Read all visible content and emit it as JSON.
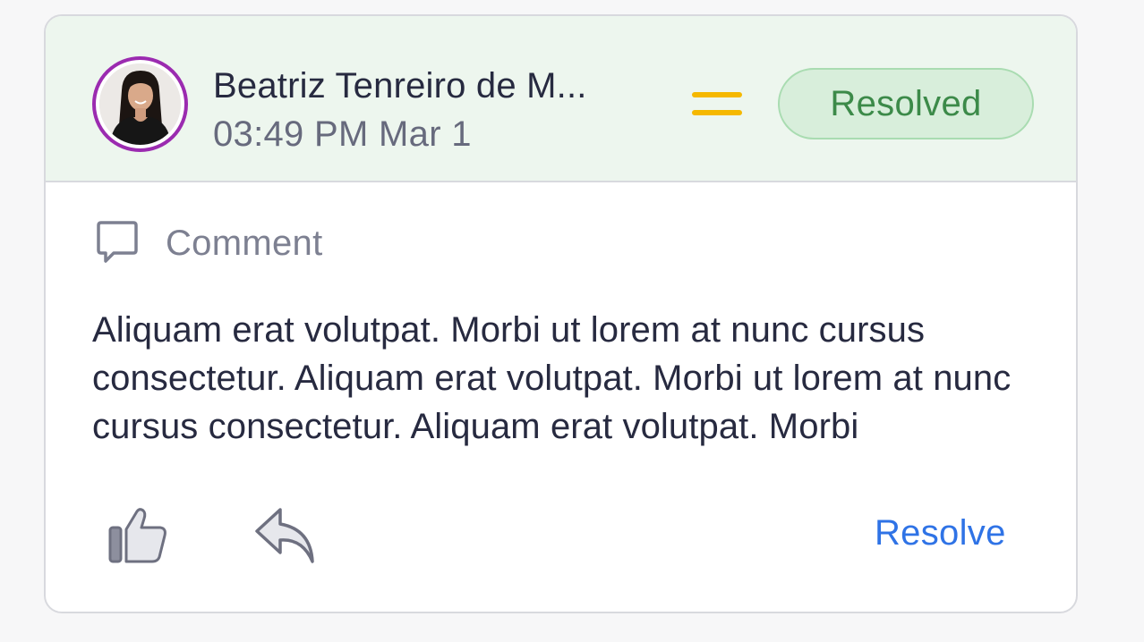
{
  "comment": {
    "author": {
      "name": "Beatriz Tenreiro de M...",
      "timestamp": "03:49 PM Mar 1"
    },
    "priority_icon": "equals-priority-icon",
    "status": "Resolved",
    "type_label": "Comment",
    "body": "Aliquam erat volutpat. Morbi ut lorem at nunc cursus consectetur. Aliquam erat volutpat. Morbi ut lorem at nunc cursus consectetur. Aliquam erat volutpat. Morbi",
    "actions": {
      "like_icon": "thumbs-up-icon",
      "reply_icon": "reply-icon",
      "resolve_label": "Resolve"
    }
  },
  "colors": {
    "header_bg": "#edf6ee",
    "avatar_ring": "#9b2bb0",
    "priority": "#f5b800",
    "status_text": "#3c8a49",
    "status_bg": "#d8eedb",
    "link": "#2f73e6",
    "text_primary": "#272a40",
    "text_secondary": "#676a7d"
  }
}
